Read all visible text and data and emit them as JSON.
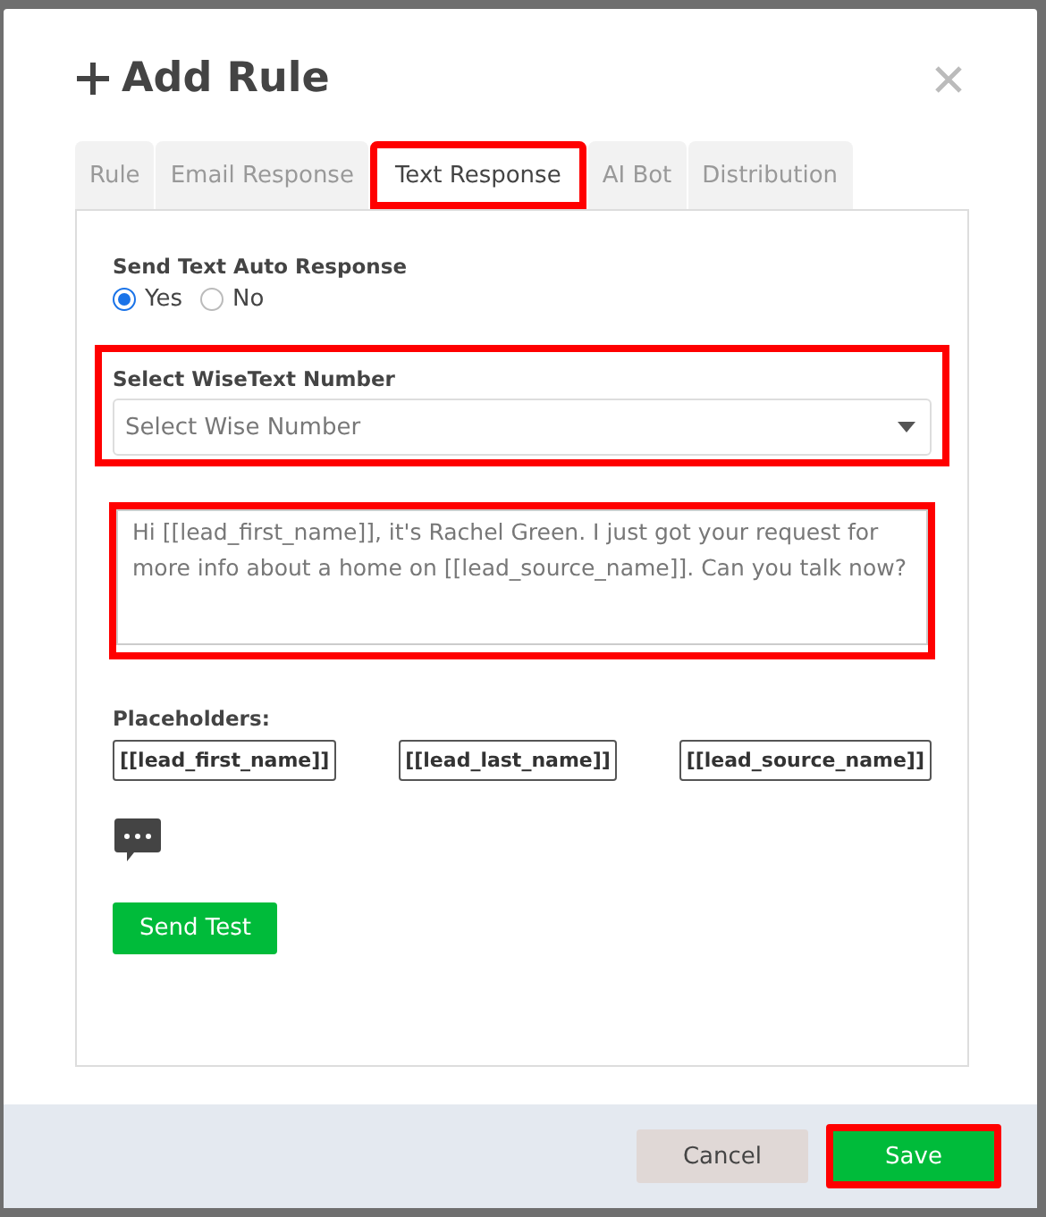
{
  "dialog": {
    "title": "Add Rule"
  },
  "tabs": [
    {
      "label": "Rule",
      "selected": false,
      "highlighted": false
    },
    {
      "label": "Email Response",
      "selected": false,
      "highlighted": false
    },
    {
      "label": "Text Response",
      "selected": true,
      "highlighted": true
    },
    {
      "label": "AI Bot",
      "selected": false,
      "highlighted": false
    },
    {
      "label": "Distribution",
      "selected": false,
      "highlighted": false
    }
  ],
  "auto_response": {
    "label": "Send Text Auto Response",
    "options": [
      {
        "label": "Yes",
        "selected": true
      },
      {
        "label": "No",
        "selected": false
      }
    ]
  },
  "number_select": {
    "label": "Select WiseText Number",
    "placeholder": "Select Wise Number",
    "highlighted": true
  },
  "message": {
    "value": "Hi [[lead_first_name]], it's Rachel Green. I just got your request for more info about a home on [[lead_source_name]]. Can you talk now?",
    "highlighted": true
  },
  "placeholders": {
    "label": "Placeholders:",
    "items": [
      "[[lead_first_name]]",
      "[[lead_last_name]]",
      "[[lead_source_name]]"
    ]
  },
  "send_test": "Send Test",
  "footer": {
    "buttons": [
      {
        "label": "Cancel",
        "kind": "secondary",
        "highlighted": false
      },
      {
        "label": "Save",
        "kind": "primary",
        "highlighted": true
      }
    ]
  }
}
